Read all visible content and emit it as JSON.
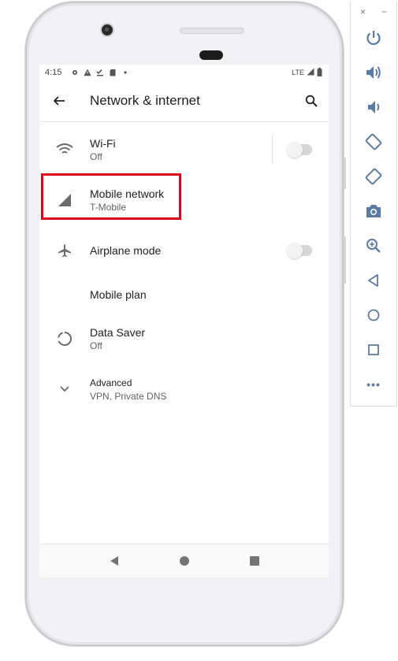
{
  "status_bar": {
    "time": "4:15",
    "network": "LTE"
  },
  "app_bar": {
    "title": "Network & internet"
  },
  "settings": [
    {
      "id": "wifi",
      "title": "Wi-Fi",
      "subtitle": "Off",
      "toggle": false
    },
    {
      "id": "mobile",
      "title": "Mobile network",
      "subtitle": "T-Mobile"
    },
    {
      "id": "airplane",
      "title": "Airplane mode",
      "toggle": false
    },
    {
      "id": "plan",
      "title": "Mobile plan"
    },
    {
      "id": "saver",
      "title": "Data Saver",
      "subtitle": "Off"
    },
    {
      "id": "advanced",
      "title": "Advanced",
      "subtitle": "VPN, Private DNS"
    }
  ],
  "highlight_color": "#e3001b",
  "emulator_toolbar": {
    "close_glyph": "×",
    "minimize_glyph": "−",
    "more_glyph": "•••",
    "icons": [
      "power-icon",
      "volume-up-icon",
      "volume-down-icon",
      "rotate-left-icon",
      "rotate-right-icon",
      "camera-icon",
      "zoom-icon",
      "back-icon",
      "home-icon",
      "overview-icon",
      "more-icon"
    ]
  }
}
